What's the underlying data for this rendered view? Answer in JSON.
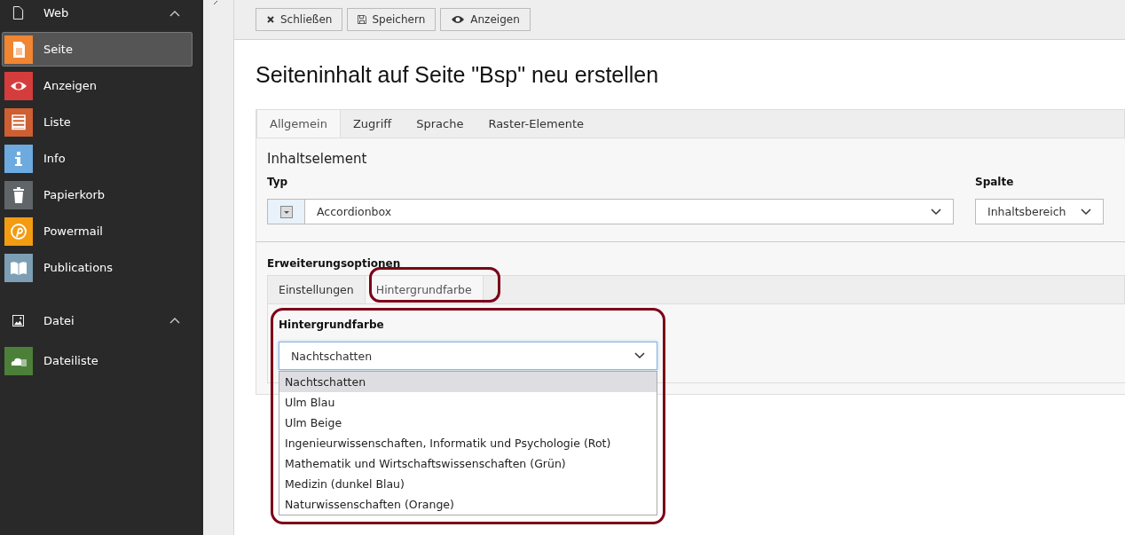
{
  "sidebar": {
    "groups": [
      {
        "label": "Web",
        "expanded": true,
        "kind": "page",
        "items": [
          {
            "label": "Seite",
            "kind": "page",
            "color": "#f08532",
            "selected": true
          },
          {
            "label": "Anzeigen",
            "kind": "eye",
            "color": "#d53d3d",
            "selected": false
          },
          {
            "label": "Liste",
            "kind": "list",
            "color": "#cd5f32",
            "selected": false
          },
          {
            "label": "Info",
            "kind": "info",
            "color": "#6daae0",
            "selected": false
          },
          {
            "label": "Papierkorb",
            "kind": "trash",
            "color": "#5f6568",
            "selected": false
          },
          {
            "label": "Powermail",
            "kind": "at",
            "color": "#f39c12",
            "selected": false
          },
          {
            "label": "Publications",
            "kind": "book",
            "color": "#7d9fb5",
            "selected": false
          }
        ]
      },
      {
        "label": "Datei",
        "expanded": true,
        "kind": "image",
        "items": [
          {
            "label": "Dateiliste",
            "kind": "cloud",
            "color": "#4c8039",
            "selected": false
          }
        ]
      }
    ]
  },
  "toolbar": [
    {
      "label": "Schließen",
      "kind": "close"
    },
    {
      "label": "Speichern",
      "kind": "save"
    },
    {
      "label": "Anzeigen",
      "kind": "eye"
    }
  ],
  "title": "Seiteninhalt auf Seite \"Bsp\" neu erstellen",
  "tabs": [
    {
      "label": "Allgemein",
      "selected": true
    },
    {
      "label": "Zugriff",
      "selected": false
    },
    {
      "label": "Sprache",
      "selected": false
    },
    {
      "label": "Raster-Elemente",
      "selected": false
    }
  ],
  "section_title": "Inhaltselement",
  "type_field": {
    "label": "Typ",
    "value": "Accordionbox"
  },
  "column_field": {
    "label": "Spalte",
    "value": "Inhaltsbereich"
  },
  "extension": {
    "title": "Erweiterungsoptionen",
    "tabs": [
      {
        "label": "Einstellungen",
        "selected": false
      },
      {
        "label": "Hintergrundfarbe",
        "selected": true
      }
    ],
    "field": {
      "label": "Hintergrundfarbe",
      "value": "Nachtschatten",
      "expanded": true,
      "options": [
        {
          "label": "Nachtschatten",
          "selected": true
        },
        {
          "label": "Ulm Blau",
          "selected": false
        },
        {
          "label": "Ulm Beige",
          "selected": false
        },
        {
          "label": "Ingenieurwissenschaften, Informatik und Psychologie (Rot)",
          "selected": false
        },
        {
          "label": "Mathematik und Wirtschaftswissenschaften (Grün)",
          "selected": false
        },
        {
          "label": "Medizin (dunkel Blau)",
          "selected": false
        },
        {
          "label": "Naturwissenschaften (Orange)",
          "selected": false
        }
      ]
    }
  }
}
